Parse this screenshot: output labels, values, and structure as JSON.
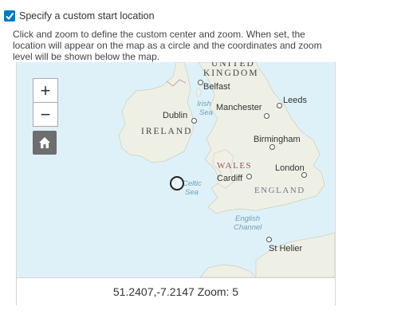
{
  "option": {
    "checked": true,
    "label": "Specify a custom start location"
  },
  "description": "Click and zoom to define the custom center and zoom. When set, the location will appear on the map as a circle and the coordinates and zoom level will be shown below the map.",
  "map": {
    "zoom_in_label": "+",
    "zoom_out_label": "−",
    "home_icon": "home-icon",
    "labels": {
      "united_kingdom_1": "UNITED",
      "united_kingdom_2": "KINGDOM",
      "belfast": "Belfast",
      "irish_sea_1": "Irish",
      "irish_sea_2": "Sea",
      "manchester": "Manchester",
      "leeds": "Leeds",
      "dublin": "Dublin",
      "ireland": "IRELAND",
      "birmingham": "Birmingham",
      "wales": "WALES",
      "london": "London",
      "cardiff": "Cardiff",
      "celtic_sea_1": "Celtic",
      "celtic_sea_2": "Sea",
      "england": "ENGLAND",
      "english_channel_1": "English",
      "english_channel_2": "Channel",
      "st_helier": "St Helier"
    },
    "colors": {
      "water": "#dff1f8",
      "land": "#eef0e6",
      "accent": "#0079c1"
    }
  },
  "coordinates_text": "51.2407,-7.2147 Zoom: 5"
}
